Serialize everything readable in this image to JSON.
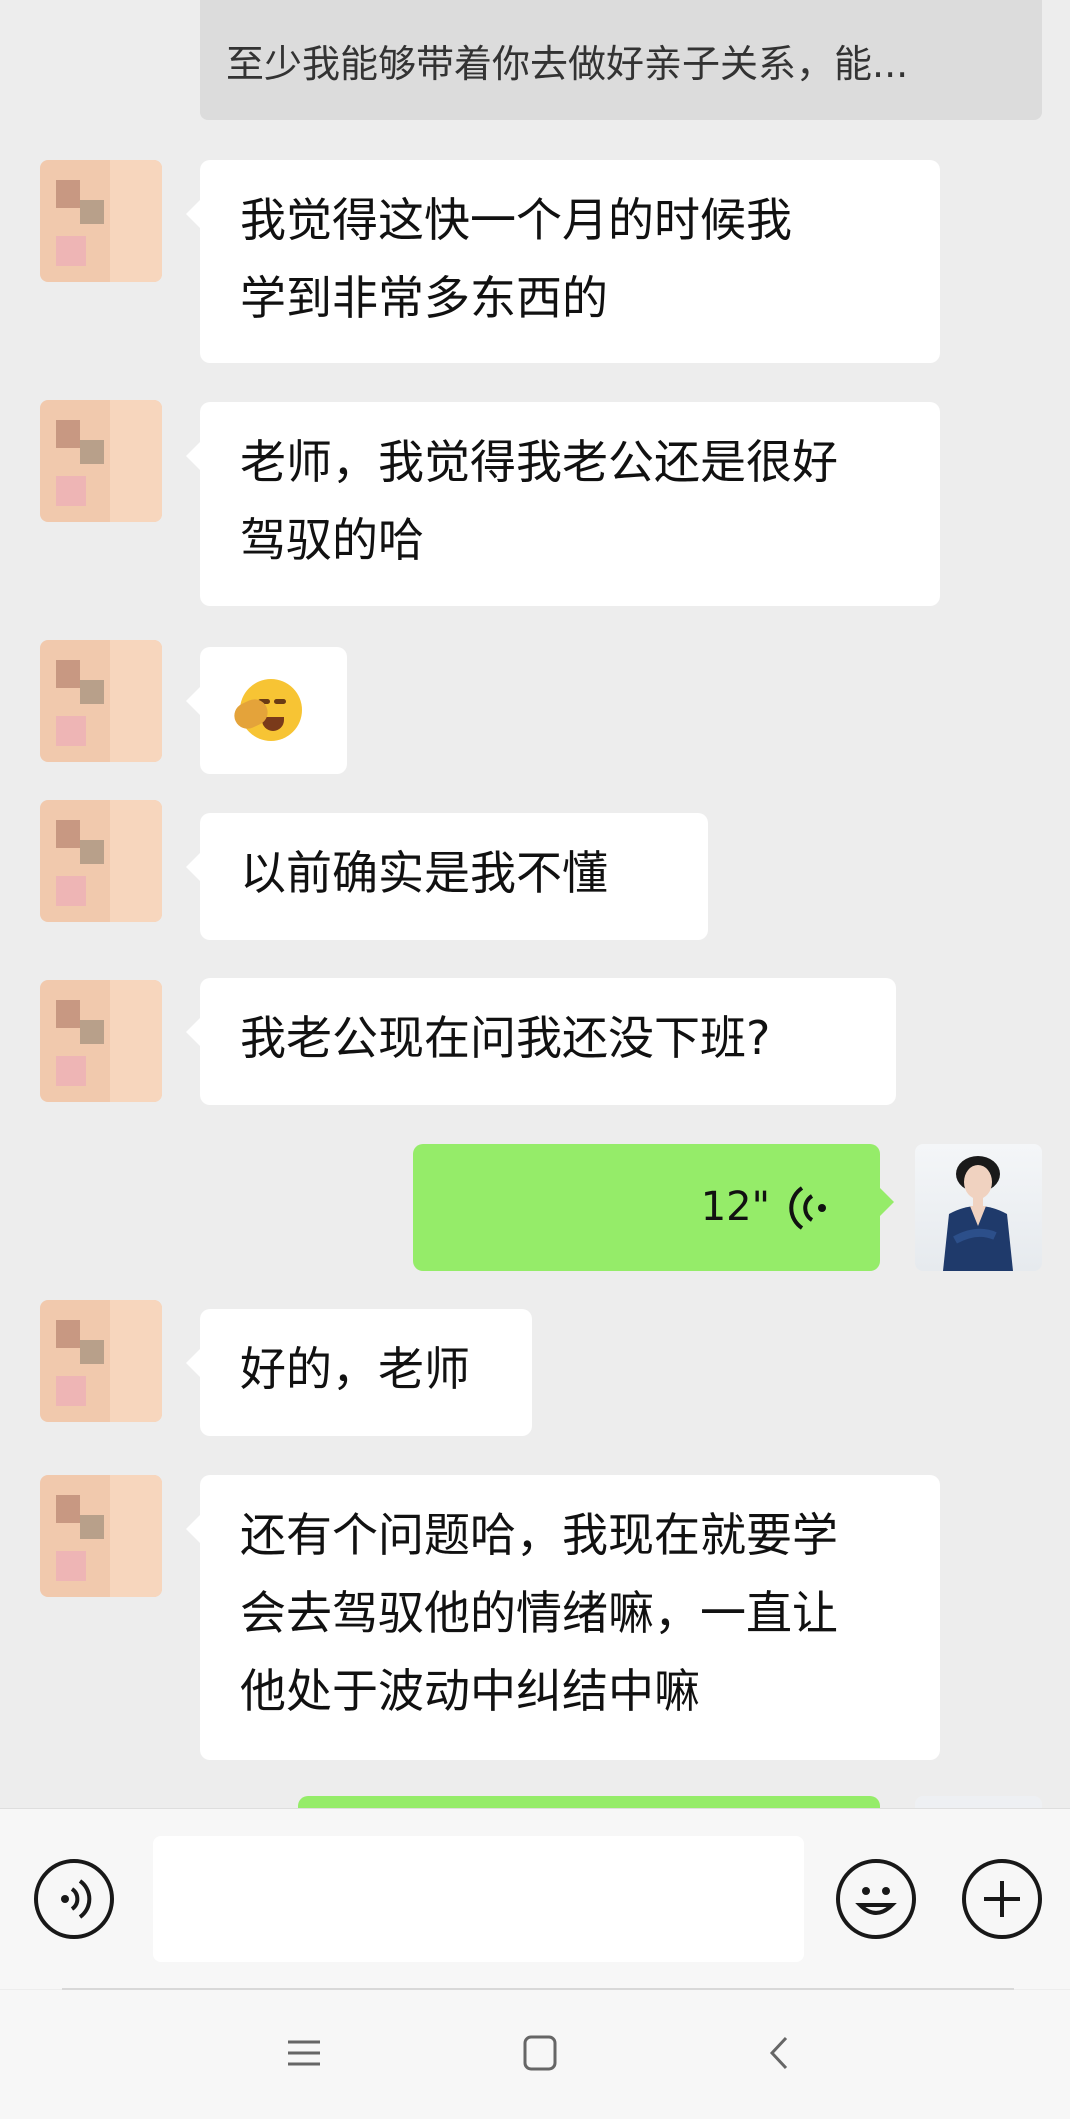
{
  "quote": {
    "text": "至少我能够带着你去做好亲子关系，能..."
  },
  "messages": [
    {
      "text": "我觉得这快一个月的时候我\n学到非常多东西的"
    },
    {
      "text": "老师，我觉得我老公还是很好\n驾驭的哈"
    },
    {
      "emoji": "face-with-hand-over-eyes"
    },
    {
      "text": "以前确实是我不懂"
    },
    {
      "text": "我老公现在问我还没下班?"
    },
    {
      "voice_duration": "12\""
    },
    {
      "text": "好的，老师"
    },
    {
      "text": "还有个问题哈，我现在就要学\n会去驾驭他的情绪嘛，一直让\n他处于波动中纠结中嘛"
    }
  ],
  "input": {
    "placeholder": "",
    "value": ""
  },
  "colors": {
    "background": "#ededed",
    "incoming_bubble": "#ffffff",
    "outgoing_bubble": "#95ec69",
    "quote_bg": "#dcdcdc"
  },
  "icons": [
    "voice-input-icon",
    "emoji-icon",
    "plus-icon",
    "menu-icon",
    "home-icon",
    "back-icon"
  ]
}
